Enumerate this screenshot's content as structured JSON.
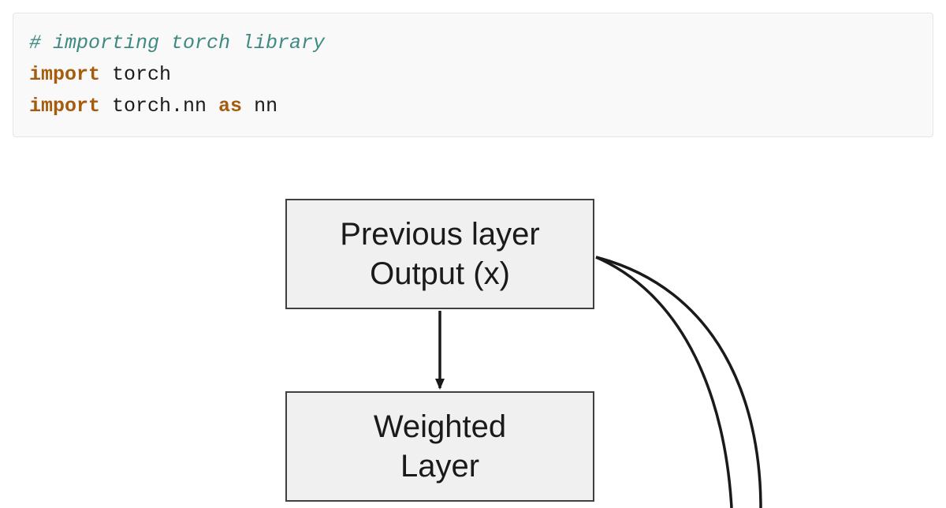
{
  "code": {
    "comment": "# importing torch library",
    "kw1": "import",
    "mod1": " torch",
    "kw2": "import",
    "mod2": " torch.nn ",
    "as": "as",
    "alias": " nn"
  },
  "diagram": {
    "box1_line1": "Previous layer",
    "box1_line2": "Output (x)",
    "box2_line1": "Weighted",
    "box2_line2": "Layer"
  }
}
